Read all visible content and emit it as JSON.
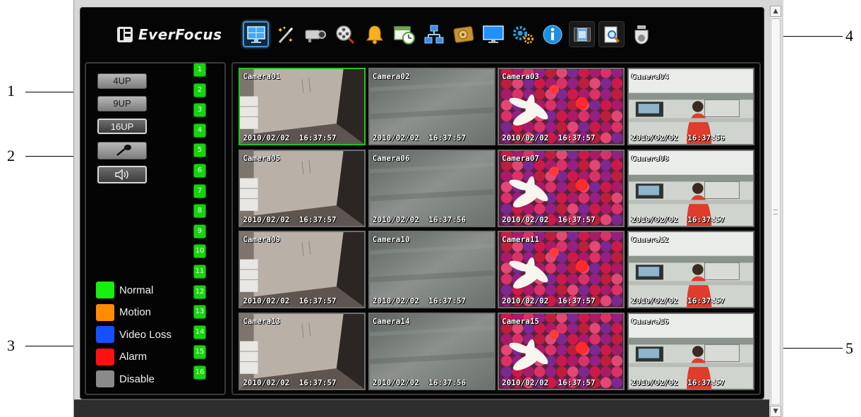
{
  "callouts": [
    {
      "number": "1"
    },
    {
      "number": "2"
    },
    {
      "number": "3"
    },
    {
      "number": "4"
    },
    {
      "number": "5"
    }
  ],
  "header": {
    "logo_text": "EverFocus",
    "toolbar_icons": [
      "live-view-icon",
      "setup-wizard-icon",
      "camera-icon",
      "playback-reel-icon",
      "alarm-bell-icon",
      "schedule-icon",
      "network-icon",
      "disk-icon",
      "display-monitor-icon",
      "system-settings-icon",
      "information-icon",
      "video-export-icon",
      "event-search-icon",
      "ptz-dome-icon"
    ]
  },
  "left_panel": {
    "layout_buttons": [
      {
        "label": "4UP"
      },
      {
        "label": "9UP"
      },
      {
        "label": "16UP",
        "selected": true
      }
    ],
    "audio_buttons": [
      "microphone-icon",
      "speaker-icon"
    ],
    "channels": [
      "1",
      "2",
      "3",
      "4",
      "5",
      "6",
      "7",
      "8",
      "9",
      "10",
      "11",
      "12",
      "13",
      "14",
      "15",
      "16"
    ],
    "channel_color": "#17d40f",
    "legend": [
      {
        "label": "Normal",
        "color": "#16f00e"
      },
      {
        "label": "Motion",
        "color": "#ff8c00"
      },
      {
        "label": "Video Loss",
        "color": "#1450ff"
      },
      {
        "label": "Alarm",
        "color": "#ff1010"
      },
      {
        "label": "Disable",
        "color": "#8a8a8a"
      }
    ]
  },
  "cameras": [
    {
      "name": "Camera01",
      "timestamp": "2010/02/02  16:37:57",
      "scene": "room",
      "focused": true
    },
    {
      "name": "Camera02",
      "timestamp": "2010/02/02  16:37:57",
      "scene": "gray"
    },
    {
      "name": "Camera03",
      "timestamp": "2010/02/02  16:37:57",
      "scene": "flowers"
    },
    {
      "name": "Camera04",
      "timestamp": "2010/02/02  16:37:56",
      "scene": "office"
    },
    {
      "name": "Camera05",
      "timestamp": "2010/02/02  16:37:57",
      "scene": "room"
    },
    {
      "name": "Camera06",
      "timestamp": "2010/02/02  16:37:56",
      "scene": "gray"
    },
    {
      "name": "Camera07",
      "timestamp": "2010/02/02  16:37:57",
      "scene": "flowers"
    },
    {
      "name": "Camera08",
      "timestamp": "2010/02/02  16:37:57",
      "scene": "office"
    },
    {
      "name": "Camera09",
      "timestamp": "2010/02/02  16:37:57",
      "scene": "room"
    },
    {
      "name": "Camera10",
      "timestamp": "2010/02/02  16:37:57",
      "scene": "gray"
    },
    {
      "name": "Camera11",
      "timestamp": "2010/02/02  16:37:57",
      "scene": "flowers"
    },
    {
      "name": "Camera12",
      "timestamp": "2010/02/02  16:37:57",
      "scene": "office"
    },
    {
      "name": "Camera13",
      "timestamp": "2010/02/02  16:37:57",
      "scene": "room"
    },
    {
      "name": "Camera14",
      "timestamp": "2010/02/02  16:37:56",
      "scene": "gray"
    },
    {
      "name": "Camera15",
      "timestamp": "2010/02/02  16:37:57",
      "scene": "flowers"
    },
    {
      "name": "Camera16",
      "timestamp": "2010/02/02  16:37:57",
      "scene": "office"
    }
  ],
  "colors": {
    "app_background": "#050505",
    "focused_border": "#22c71a",
    "tile_border": "#6e6e6e"
  }
}
